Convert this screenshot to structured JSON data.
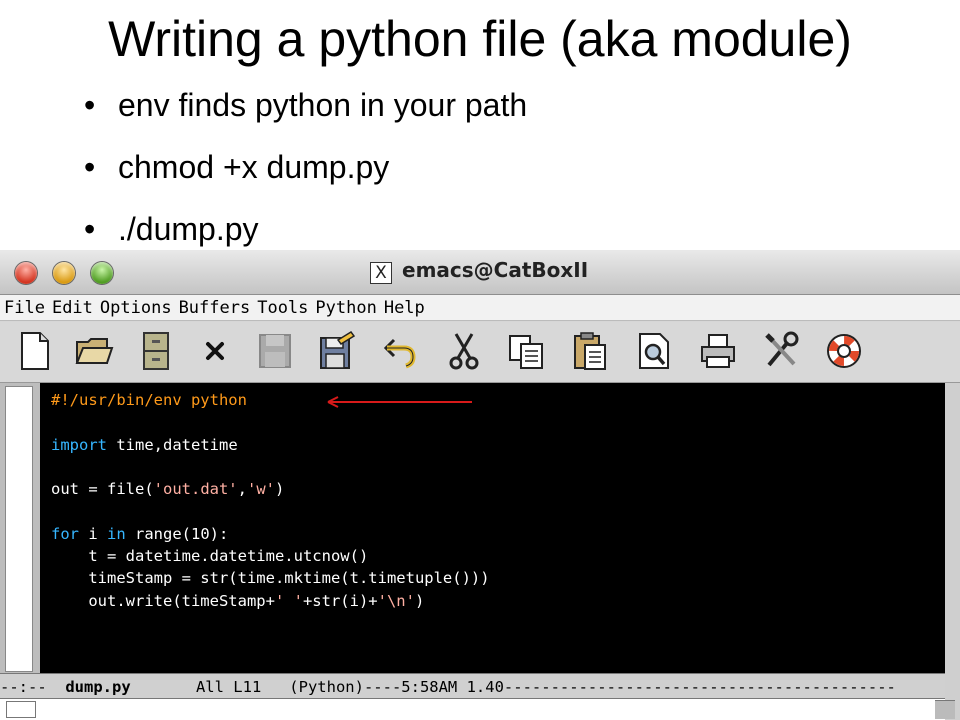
{
  "slide": {
    "title": "Writing a python file (aka module)",
    "bullets": [
      "env finds python in your path",
      "chmod +x dump.py",
      "./dump.py"
    ],
    "bullet_glyph": "•"
  },
  "window": {
    "x_glyph": "X",
    "title": "emacs@CatBoxII"
  },
  "menubar": {
    "items": [
      "File",
      "Edit",
      "Options",
      "Buffers",
      "Tools",
      "Python",
      "Help"
    ]
  },
  "toolbar": {
    "tools": [
      "new-file-icon",
      "open-folder-icon",
      "cabinet-icon",
      "close-icon",
      "save-disabled-icon",
      "save-icon",
      "undo-icon",
      "cut-icon",
      "copy-icon",
      "paste-icon",
      "search-icon",
      "print-icon",
      "tools-icon",
      "help-icon"
    ]
  },
  "editor": {
    "lines": {
      "shebang": "#!/usr/bin/env python",
      "import_kw": "import",
      "import_rest": " time,datetime",
      "out_pre": "out = file(",
      "out_str1": "'out.dat'",
      "out_comma": ",",
      "out_str2": "'w'",
      "out_end": ")",
      "for_kw": "for",
      "for_mid": " i ",
      "in_kw": "in",
      "for_rest": " range(10):",
      "line_t": "    t = datetime.datetime.utcnow()",
      "line_ts": "    timeStamp = str(time.mktime(t.timetuple()))",
      "write_pre": "    out.write(timeStamp+",
      "write_str1": "' '",
      "write_mid": "+str(i)+",
      "write_str2": "'\\n'",
      "write_end": ")"
    }
  },
  "modeline": {
    "prefix": "--:--  ",
    "buffer": "dump.py",
    "rest": "       All L11   (Python)----5:58AM 1.40------------------------------------------"
  },
  "colors": {
    "comment": "#ff9a1a",
    "keyword": "#36b6ff",
    "string": "#ffb0a3",
    "arrow": "#d81a1a"
  }
}
